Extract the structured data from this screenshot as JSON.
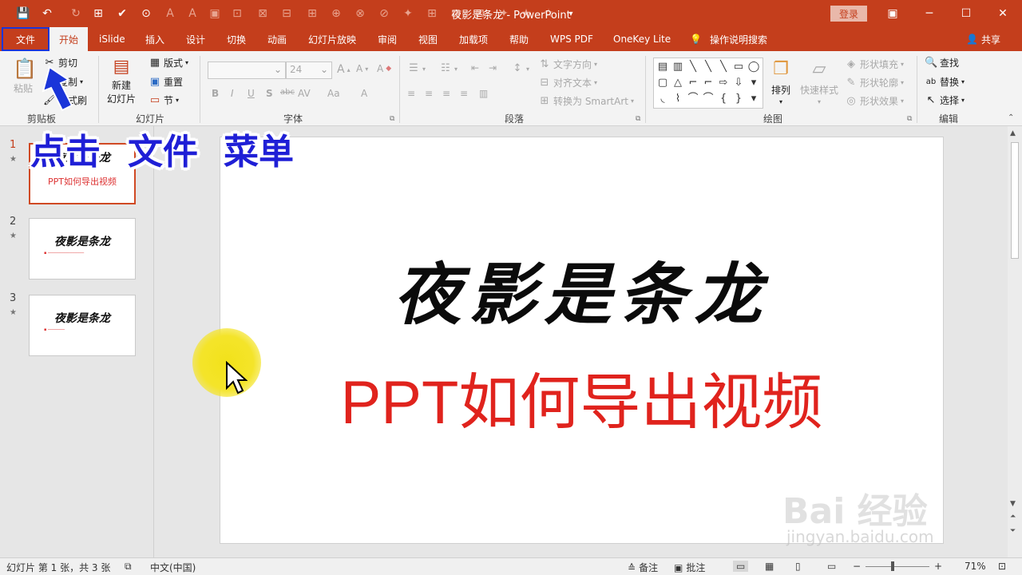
{
  "window": {
    "title": "夜影是条龙 - PowerPoint",
    "login_label": "登录",
    "minimize": "─",
    "maximize": "☐",
    "close": "✕",
    "restore_ribbon": "▣"
  },
  "qat": [
    "💾",
    "↶",
    "↻",
    "⊞",
    "✔",
    "⊙",
    "A",
    "A",
    "▣",
    "⊡",
    "⊠",
    "⊟",
    "⊞",
    "⊕",
    "⊗",
    "⊘",
    "✦",
    "★",
    "☆",
    "▾"
  ],
  "tabs": [
    "文件",
    "开始",
    "iSlide",
    "插入",
    "设计",
    "切换",
    "动画",
    "幻灯片放映",
    "审阅",
    "视图",
    "加载项",
    "帮助",
    "WPS PDF",
    "OneKey Lite"
  ],
  "tell_me": "操作说明搜索",
  "share": "共享",
  "clipboard": {
    "paste": "粘贴",
    "cut": "剪切",
    "copy": "复制",
    "format_painter": "格式刷",
    "label": "剪贴板"
  },
  "slides_group": {
    "new_slide": "新建",
    "new_slide2": "幻灯片",
    "layout": "版式",
    "reset": "重置",
    "section": "节",
    "label": "幻灯片"
  },
  "font_group": {
    "font_size": "24",
    "label": "字体",
    "buttons": [
      "B",
      "I",
      "U",
      "S",
      "abc",
      "AV",
      "Aa",
      "A"
    ]
  },
  "paragraph_group": {
    "text_direction": "文字方向",
    "align_text": "对齐文本",
    "smartart": "转换为 SmartArt",
    "label": "段落"
  },
  "drawing_group": {
    "arrange": "排列",
    "quick_styles": "快速样式",
    "shape_fill": "形状填充",
    "shape_outline": "形状轮廓",
    "shape_effects": "形状效果",
    "label": "绘图",
    "shapes": [
      "▤",
      "▥",
      "╲",
      "╲",
      "╲",
      "▭",
      "◯",
      "▢",
      "△",
      "⌐",
      "⌐",
      "⇨",
      "⇩",
      "▾",
      "◟",
      "⌇",
      "⌒",
      "⌒",
      "{",
      "}",
      "▾"
    ]
  },
  "editing_group": {
    "find": "查找",
    "replace": "替换",
    "select": "选择",
    "label": "编辑"
  },
  "thumbnails": [
    {
      "num": "1",
      "title": "夜影是条龙",
      "subtitle": "PPT如何导出视频"
    },
    {
      "num": "2",
      "title": "夜影是条龙",
      "subtitle": "▪ ───────────────"
    },
    {
      "num": "3",
      "title": "夜影是条龙",
      "subtitle": "▪ ───────"
    }
  ],
  "slide": {
    "title": "夜影是条龙",
    "subtitle": "PPT如何导出视频"
  },
  "status": {
    "slide_info": "幻灯片 第 1 张，共 3 张",
    "language": "中文(中国)",
    "notes": "备注",
    "comments": "批注",
    "zoom": "71%"
  },
  "callouts": [
    "点击",
    "文件",
    "菜单"
  ],
  "watermark": "Bai 经验",
  "watermark_url": "jingyan.baidu.com",
  "colors": {
    "accent": "#c43e1c",
    "callout_text": "#1f1fd6",
    "slide_subtitle": "#e0231d"
  }
}
